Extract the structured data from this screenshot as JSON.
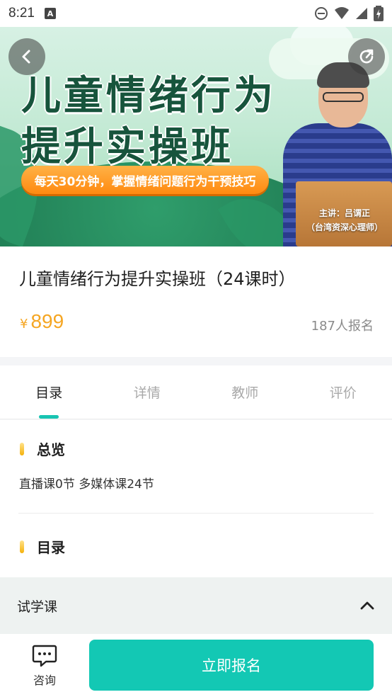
{
  "status": {
    "time": "8:21",
    "notification_icon": "A"
  },
  "banner": {
    "title_line1": "儿童情绪行为",
    "title_line2": "提升实操班",
    "tagline": "每天30分钟，掌握情绪问题行为干预技巧",
    "lecturer": "主讲：吕谓正",
    "lecturer_title": "（台湾资深心理师）"
  },
  "course": {
    "title": "儿童情绪行为提升实操班（24课时）",
    "currency": "¥",
    "price": "899",
    "enroll_count": "187人报名"
  },
  "tabs": [
    {
      "label": "目录",
      "active": true
    },
    {
      "label": "详情",
      "active": false
    },
    {
      "label": "教师",
      "active": false
    },
    {
      "label": "评价",
      "active": false
    }
  ],
  "overview": {
    "heading": "总览",
    "text": "直播课0节  多媒体课24节"
  },
  "catalog": {
    "heading": "目录"
  },
  "trial": {
    "label": "试学课"
  },
  "bottom": {
    "consult_label": "咨询",
    "enroll_button": "立即报名"
  },
  "colors": {
    "accent": "#13c8b4",
    "price": "#f5a623",
    "section_marker": "#f5b10b"
  }
}
